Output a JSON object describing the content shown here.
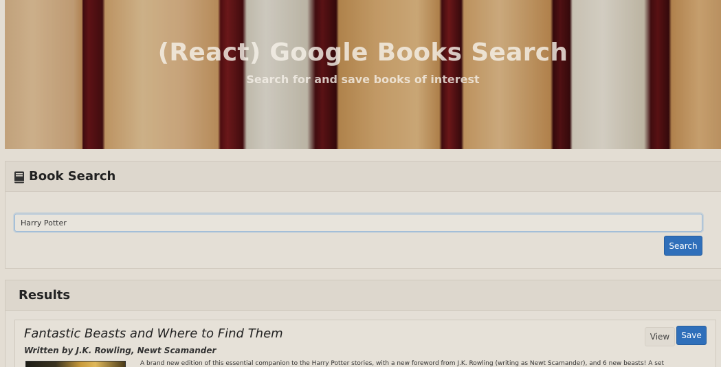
{
  "hero": {
    "title": "(React) Google Books Search",
    "subtitle": "Search for and save books of interest"
  },
  "search": {
    "heading": "Book Search",
    "heading_icon": "book-icon",
    "input_value": "Harry Potter",
    "button_label": "Search"
  },
  "results": {
    "heading": "Results",
    "items": [
      {
        "title": "Fantastic Beasts and Where to Find Them",
        "authors": "Written by J.K. Rowling, Newt Scamander",
        "description": "A brand new edition of this essential companion to the Harry Potter stories, with a new foreword from J.K. Rowling (writing as Newt Scamander), and 6 new beasts! A set",
        "view_label": "View",
        "save_label": "Save"
      }
    ]
  },
  "colors": {
    "primary": "#2f6fba",
    "background": "#e3ddd3"
  }
}
